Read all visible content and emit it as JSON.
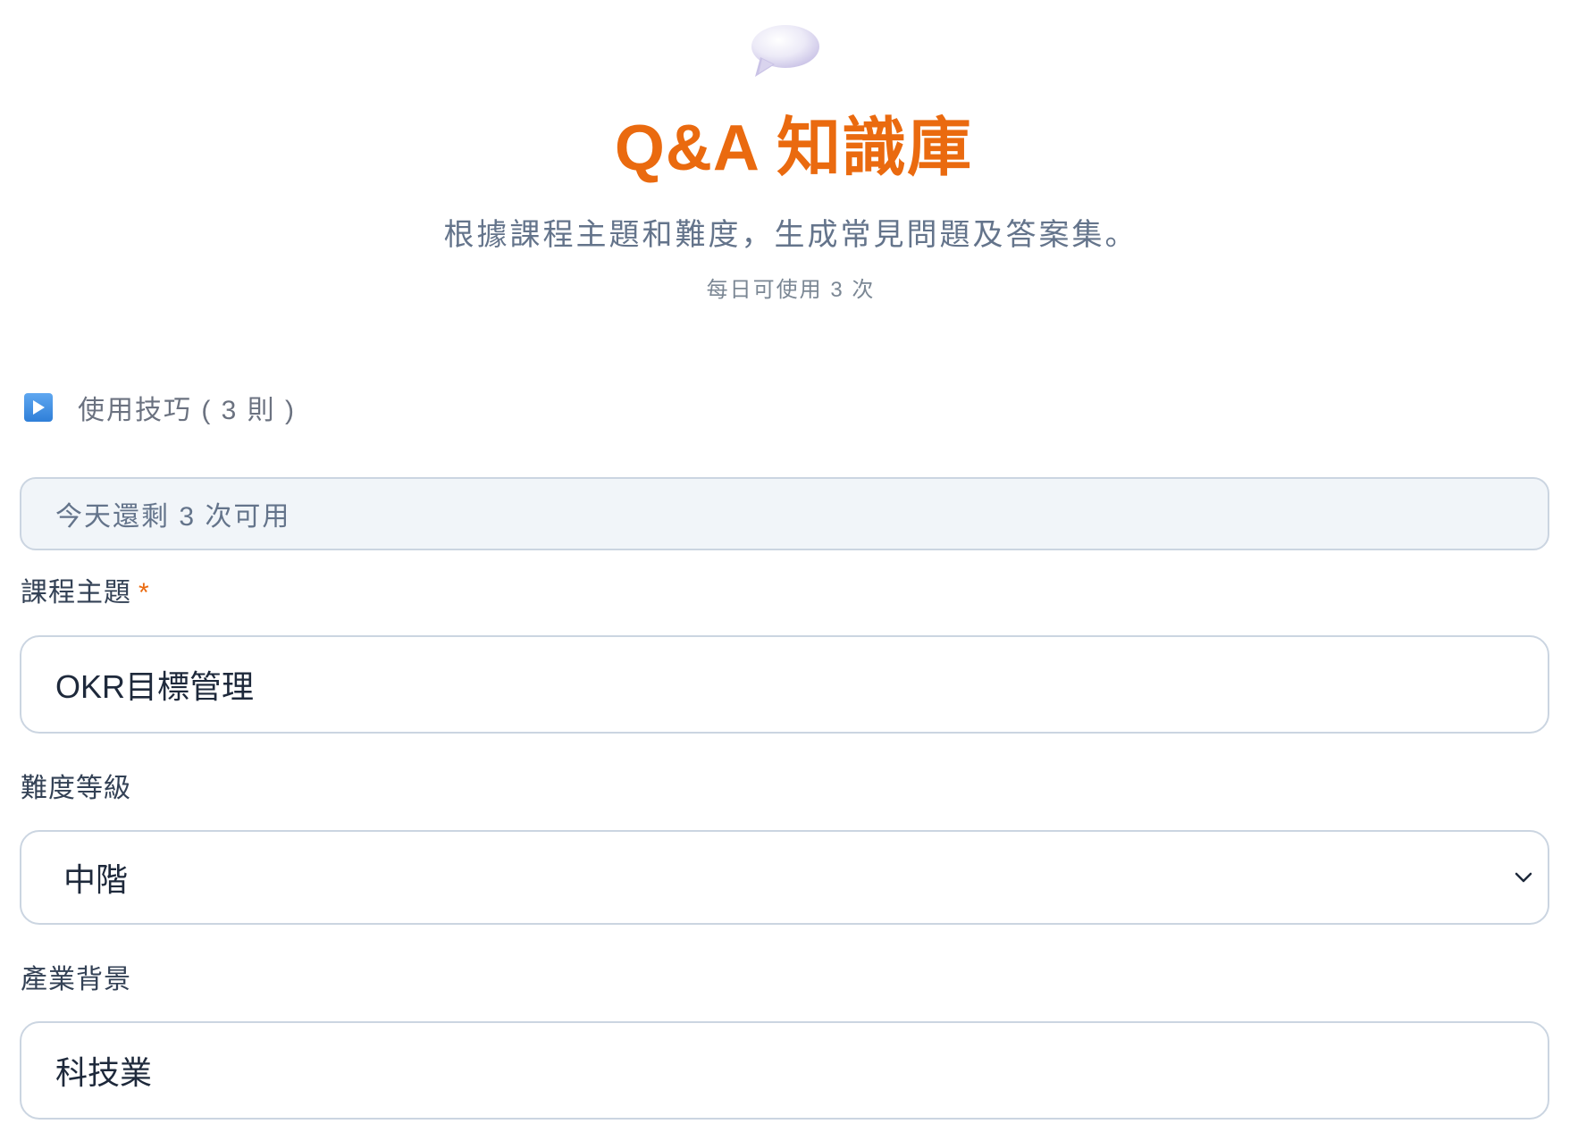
{
  "header": {
    "icon": "speech-bubble-icon",
    "title": "Q&A 知識庫",
    "subtitle": "根據課程主題和難度，生成常見問題及答案集。",
    "usage_limit": "每日可使用 3 次"
  },
  "tips": {
    "icon": "play-button-icon",
    "label": "使用技巧 ( 3 則 )"
  },
  "remaining": {
    "text": "今天還剩 3 次可用"
  },
  "form": {
    "course_topic": {
      "label": "課程主題",
      "required_mark": "*",
      "value": "OKR目標管理"
    },
    "difficulty": {
      "label": "難度等級",
      "selected": "中階"
    },
    "industry": {
      "label": "產業背景",
      "value": "科技業"
    }
  },
  "colors": {
    "accent": "#ea6a0f",
    "muted_text": "#64748b",
    "border": "#cbd5e1",
    "info_bg": "#f1f5f9"
  }
}
